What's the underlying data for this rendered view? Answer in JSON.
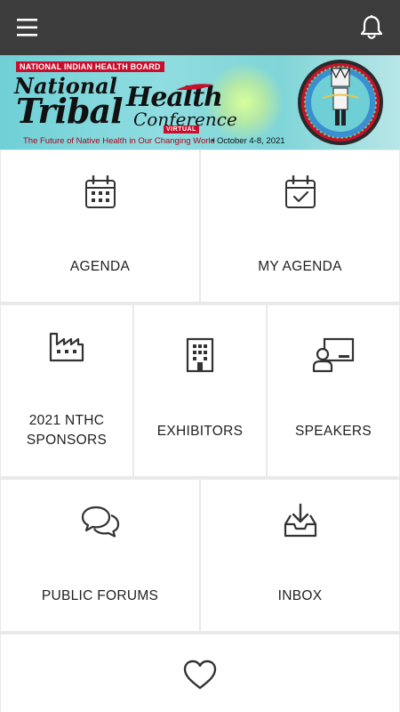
{
  "appbar": {
    "menu_icon": "hamburger-menu-icon",
    "notifications_icon": "bell-icon",
    "background": "#3c3c3c"
  },
  "banner": {
    "organization": "NATIONAL INDIAN HEALTH BOARD",
    "title_line1": "National",
    "title_line2": "Tribal",
    "title_line3": "Health",
    "title_line4": "Conference",
    "badge": "VIRTUAL",
    "tagline": "The Future of Native Health in Our Changing World",
    "dates": "• October 4-8, 2021",
    "accent_color": "#c8102e"
  },
  "tiles": [
    {
      "label": "AGENDA",
      "icon": "calendar-icon"
    },
    {
      "label": "MY AGENDA",
      "icon": "calendar-check-icon"
    },
    {
      "label": "2021 NTHC SPONSORS",
      "icon": "factory-icon"
    },
    {
      "label": "EXHIBITORS",
      "icon": "building-icon"
    },
    {
      "label": "SPEAKERS",
      "icon": "presenter-board-icon"
    },
    {
      "label": "PUBLIC FORUMS",
      "icon": "chat-bubbles-icon"
    },
    {
      "label": "INBOX",
      "icon": "inbox-download-icon"
    },
    {
      "label": "",
      "icon": "heart-icon"
    }
  ]
}
